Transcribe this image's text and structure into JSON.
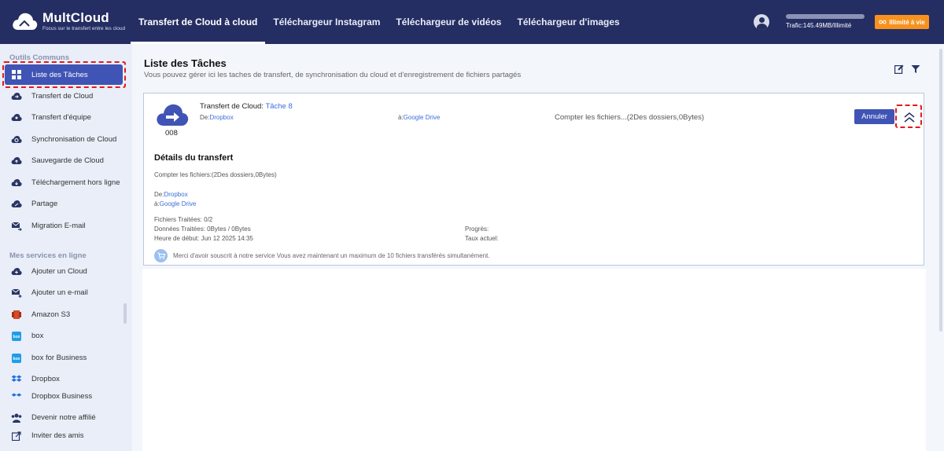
{
  "brand": {
    "title": "MultCloud",
    "subtitle": "Focus sur le transfert entre les cloud"
  },
  "nav": {
    "items": [
      {
        "label": "Transfert de Cloud à cloud",
        "active": true
      },
      {
        "label": "Téléchargeur Instagram",
        "active": false
      },
      {
        "label": "Téléchargeur de vidéos",
        "active": false
      },
      {
        "label": "Téléchargeur d'images",
        "active": false
      }
    ]
  },
  "header": {
    "traffic": "Trafic:145.49MB/Illimité",
    "unlimited_label": "Illimité à vie",
    "user_icon": "user-icon"
  },
  "sidebar": {
    "common_title": "Outils Communs",
    "common_items": [
      {
        "label": "Liste des Tâches",
        "icon": "grid-icon",
        "active": true
      },
      {
        "label": "Transfert de Cloud",
        "icon": "cloud-transfer-icon"
      },
      {
        "label": "Transfert d'équipe",
        "icon": "team-transfer-icon"
      },
      {
        "label": "Synchronisation de Cloud",
        "icon": "cloud-sync-icon"
      },
      {
        "label": "Sauvegarde de Cloud",
        "icon": "cloud-backup-icon"
      },
      {
        "label": "Téléchargement hors ligne",
        "icon": "offline-download-icon"
      },
      {
        "label": "Partage",
        "icon": "share-icon"
      },
      {
        "label": "Migration E-mail",
        "icon": "email-migration-icon"
      }
    ],
    "services_title": "Mes services en ligne",
    "service_items": [
      {
        "label": "Ajouter un Cloud",
        "icon": "add-cloud-icon"
      },
      {
        "label": "Ajouter un e-mail",
        "icon": "add-email-icon"
      },
      {
        "label": "Amazon S3",
        "icon": "amazon-s3-icon"
      },
      {
        "label": "box",
        "icon": "box-icon"
      },
      {
        "label": "box for Business",
        "icon": "box-business-icon"
      },
      {
        "label": "Dropbox",
        "icon": "dropbox-icon"
      },
      {
        "label": "Dropbox Business",
        "icon": "dropbox-business-icon"
      }
    ],
    "bottom_items": [
      {
        "label": "Devenir notre affilié",
        "icon": "affiliate-icon"
      },
      {
        "label": "Inviter des amis",
        "icon": "invite-icon"
      }
    ]
  },
  "main": {
    "title": "Liste des Tâches",
    "subtitle": "Vous pouvez gérer ici les taches de transfert, de synchronisation du cloud et d'enregistrement de fichiers partagés"
  },
  "task": {
    "number": "008",
    "title_prefix": "Transfert de Cloud:",
    "title_name": "Tâche 8",
    "from_prefix": "De:",
    "from_service": "Dropbox",
    "to_prefix": "à:",
    "to_service": "Google Drive",
    "count_status": "Compter les fichiers...(2Des dossiers,0Bytes)",
    "cancel_label": "Annuler"
  },
  "details": {
    "title": "Détails du transfert",
    "count": "Compter les fichiers:(2Des dossiers,0Bytes)",
    "from_prefix": "De:",
    "from_service": "Dropbox",
    "to_prefix": "à:",
    "to_service": "Google Drive",
    "files_processed": "Fichiers Traitées: 0/2",
    "data_processed": "Données Traitées: 0Bytes / 0Bytes",
    "start_time": "Heure de début: Jun 12 2025 14:35",
    "progress": "Progrès:",
    "current_rate": "Taux actuel:",
    "notice": "Merci d'avoir souscrit à notre service Vous avez maintenant un maximum de 10 fichiers transférés simultanément."
  },
  "colors": {
    "topbar": "#242e63",
    "accent": "#3f54b5",
    "orange": "#f7921e",
    "link": "#3a6fd8",
    "highlight": "#e4191c"
  }
}
